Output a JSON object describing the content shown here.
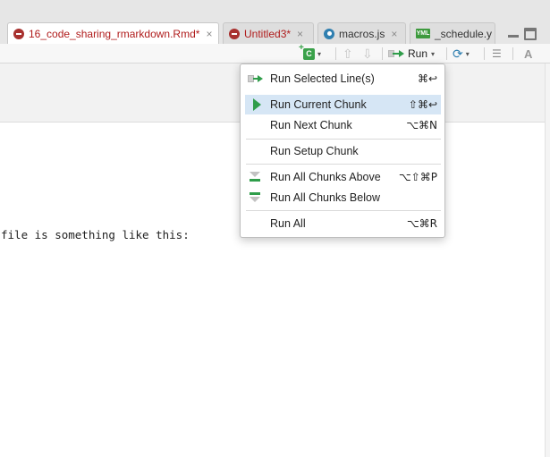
{
  "tabs": [
    {
      "label": "16_code_sharing_rmarkdown.Rmd*",
      "icon": "rmarkdown-file-icon",
      "modified": true,
      "active": true
    },
    {
      "label": "Untitled3*",
      "icon": "rmarkdown-file-icon",
      "modified": true,
      "active": false
    },
    {
      "label": "macros.js",
      "icon": "javascript-file-icon",
      "modified": false,
      "active": false
    },
    {
      "label": "_schedule.y",
      "icon": "yaml-file-icon",
      "modified": false,
      "active": false
    }
  ],
  "tab_close_glyph": "×",
  "yml_icon_text": "YML",
  "toolbar": {
    "insert_chunk_glyph": "C",
    "run_label": "Run"
  },
  "editor": {
    "visible_line": "file is something like this:"
  },
  "run_menu": {
    "items": [
      {
        "label": "Run Selected Line(s)",
        "shortcut": "⌘↩",
        "icon": "run-selected-icon",
        "highlighted": false
      },
      {
        "label": "Run Current Chunk",
        "shortcut": "⇧⌘↩",
        "icon": "play-icon",
        "highlighted": true
      },
      {
        "label": "Run Next Chunk",
        "shortcut": "⌥⌘N",
        "icon": "",
        "highlighted": false
      },
      {
        "label": "Run Setup Chunk",
        "shortcut": "",
        "icon": "",
        "highlighted": false
      },
      {
        "label": "Run All Chunks Above",
        "shortcut": "⌥⇧⌘P",
        "icon": "run-above-icon",
        "highlighted": false
      },
      {
        "label": "Run All Chunks Below",
        "shortcut": "",
        "icon": "run-below-icon",
        "highlighted": false
      },
      {
        "label": "Run All",
        "shortcut": "⌥⌘R",
        "icon": "",
        "highlighted": false
      }
    ]
  },
  "colors": {
    "modified_tab_text": "#b01c1c",
    "menu_highlight": "#d6e6f5",
    "run_green": "#2f9d4a"
  }
}
